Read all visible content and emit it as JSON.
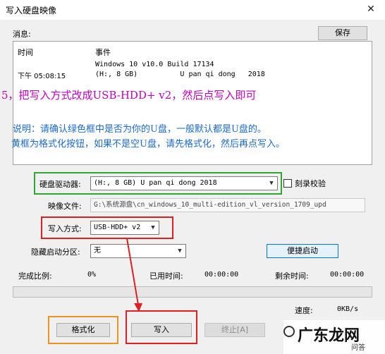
{
  "window": {
    "title": "写入硬盘映像",
    "close_glyph": "✕"
  },
  "messages_label": "消息:",
  "save_label": "保存",
  "log": {
    "col_time": "时间",
    "col_event": "事件",
    "rows": [
      {
        "time": "",
        "event": "Windows 10 v10.0 Build 17134"
      },
      {
        "time": "下午 05:08:15",
        "event": "(H:, 8 GB)          U pan qi dong   2018"
      }
    ]
  },
  "annotations": {
    "step": "5，把写入方式改成USB-HDD+ v2，然后点写入即可",
    "note1": "说明：请确认绿色框中是否为你的U盘，一般默认都是U盘的。",
    "note2": "黄框为格式化按钮，如果不是空U盘，请先格式化，然后再点写入。"
  },
  "drive": {
    "label": "硬盘驱动器:",
    "value": "(H:, 8 GB)          U pan qi dong   2018"
  },
  "verify": {
    "label": "刻录校验",
    "checked": false
  },
  "image_file": {
    "label": "映像文件:",
    "value": "G:\\系统源盘\\cn_windows_10_multi-edition_vl_version_1709_upd"
  },
  "write_method": {
    "label": "写入方式:",
    "value": "USB-HDD+ v2"
  },
  "hidden_partition": {
    "label": "隐藏启动分区:",
    "value": "无"
  },
  "quick_boot_label": "便捷启动",
  "stats": {
    "done_label": "完成比例:",
    "done_value": "0%",
    "elapsed_label": "已用时间:",
    "elapsed_value": "00:00:00",
    "remaining_label": "剩余时间:",
    "remaining_value": "00:00:00",
    "speed_label": "速度:",
    "speed_value": "0KB/s",
    "progress": 0
  },
  "buttons": {
    "format": "格式化",
    "write": "写入",
    "abort": "终止[A]"
  },
  "watermark": {
    "text": "广东龙网",
    "sub": "问答"
  },
  "colors": {
    "green_frame": "#2ea82e",
    "red_frame": "#e02020",
    "orange_frame": "#f0921e",
    "purple_text": "#c000c0",
    "blue_text": "#1a6ad2"
  }
}
